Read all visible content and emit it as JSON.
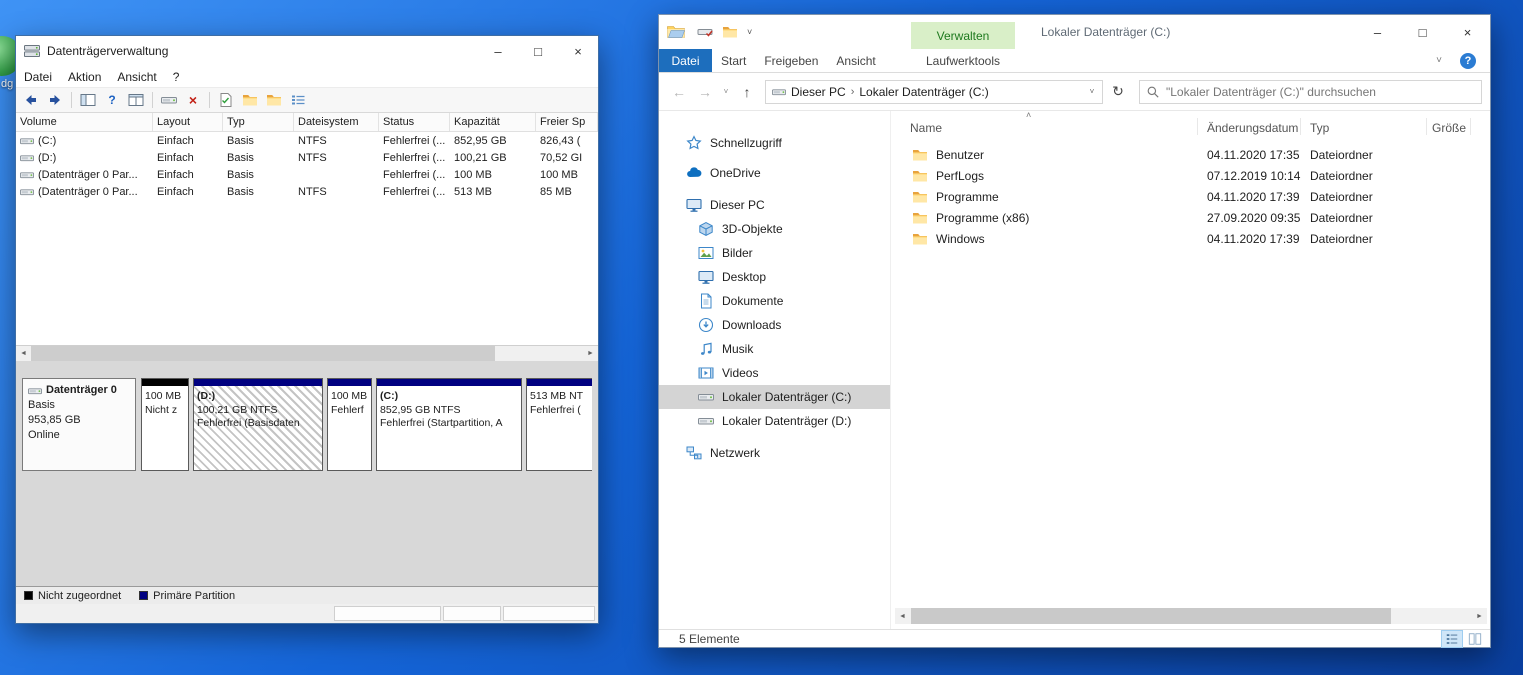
{
  "desktop": {
    "icon_label_fragment": "dg"
  },
  "glyphs": {
    "minimize": "–",
    "maximize": "□",
    "close": "×",
    "back": "←",
    "forward": "→",
    "up": "↑",
    "chevron_down": "˅",
    "caret_up": "˄",
    "refresh": "↻",
    "breadcrumb_sep": "›",
    "scroll_left": "◄",
    "scroll_right": "►",
    "help": "?",
    "delete_x": "×"
  },
  "colors": {
    "primary_partition": "#000080",
    "unallocated": "#000000",
    "file_tab_blue": "#1d6ebd",
    "manage_tab_green_bg": "#d9efc8",
    "manage_tab_green_text": "#1f7a1f",
    "sidebar_selection": "#d4d4d4",
    "folder_yellow": "#ffd978"
  },
  "disk_mgmt": {
    "title": "Datenträgerverwaltung",
    "menu": {
      "datei": "Datei",
      "aktion": "Aktion",
      "ansicht": "Ansicht",
      "hilfe": "?"
    },
    "volumes": {
      "headers": [
        "Volume",
        "Layout",
        "Typ",
        "Dateisystem",
        "Status",
        "Kapazität",
        "Freier Sp"
      ],
      "rows": [
        {
          "volume": "(C:)",
          "layout": "Einfach",
          "typ": "Basis",
          "fs": "NTFS",
          "status": "Fehlerfrei (...",
          "kapazitaet": "852,95 GB",
          "frei": "826,43 ("
        },
        {
          "volume": "(D:)",
          "layout": "Einfach",
          "typ": "Basis",
          "fs": "NTFS",
          "status": "Fehlerfrei (...",
          "kapazitaet": "100,21 GB",
          "frei": "70,52 GI"
        },
        {
          "volume": "(Datenträger 0 Par...",
          "layout": "Einfach",
          "typ": "Basis",
          "fs": "",
          "status": "Fehlerfrei (...",
          "kapazitaet": "100 MB",
          "frei": "100 MB"
        },
        {
          "volume": "(Datenträger 0 Par...",
          "layout": "Einfach",
          "typ": "Basis",
          "fs": "NTFS",
          "status": "Fehlerfrei (...",
          "kapazitaet": "513 MB",
          "frei": "85 MB"
        }
      ]
    },
    "disk0": {
      "name": "Datenträger 0",
      "typ": "Basis",
      "size": "953,85 GB",
      "status": "Online",
      "partitions": [
        {
          "line1": "100 MB",
          "line2": "Nicht z",
          "line3": ""
        },
        {
          "line1": "(D:)",
          "line2": "100,21 GB NTFS",
          "line3": "Fehlerfrei (Basisdaten"
        },
        {
          "line1": "100 MB",
          "line2": "Fehlerf",
          "line3": ""
        },
        {
          "line1": "(C:)",
          "line2": "852,95 GB NTFS",
          "line3": "Fehlerfrei (Startpartition, A"
        },
        {
          "line1": "513 MB NT",
          "line2": "Fehlerfrei (",
          "line3": ""
        }
      ]
    },
    "legend": {
      "unallocated": "Nicht zugeordnet",
      "primary": "Primäre Partition"
    }
  },
  "explorer": {
    "title": "Lokaler Datenträger (C:)",
    "manage_tab": "Verwalten",
    "file_tab": "Datei",
    "tabs": [
      "Start",
      "Freigeben",
      "Ansicht"
    ],
    "tool_tab": "Laufwerktools",
    "breadcrumb": {
      "root": "Dieser PC",
      "current": "Lokaler Datenträger (C:)"
    },
    "search_placeholder": "\"Lokaler Datenträger (C:)\" durchsuchen",
    "sidebar": {
      "items": [
        {
          "label": "Schnellzugriff"
        },
        {
          "label": "OneDrive"
        },
        {
          "label": "Dieser PC"
        },
        {
          "label": "3D-Objekte"
        },
        {
          "label": "Bilder"
        },
        {
          "label": "Desktop"
        },
        {
          "label": "Dokumente"
        },
        {
          "label": "Downloads"
        },
        {
          "label": "Musik"
        },
        {
          "label": "Videos"
        },
        {
          "label": "Lokaler Datenträger (C:)"
        },
        {
          "label": "Lokaler Datenträger (D:)"
        },
        {
          "label": "Netzwerk"
        }
      ]
    },
    "list": {
      "headers": [
        "Name",
        "Änderungsdatum",
        "Typ",
        "Größe"
      ],
      "rows": [
        {
          "name": "Benutzer",
          "date": "04.11.2020 17:35",
          "type": "Dateiordner",
          "size": ""
        },
        {
          "name": "PerfLogs",
          "date": "07.12.2019 10:14",
          "type": "Dateiordner",
          "size": ""
        },
        {
          "name": "Programme",
          "date": "04.11.2020 17:39",
          "type": "Dateiordner",
          "size": ""
        },
        {
          "name": "Programme (x86)",
          "date": "27.09.2020 09:35",
          "type": "Dateiordner",
          "size": ""
        },
        {
          "name": "Windows",
          "date": "04.11.2020 17:39",
          "type": "Dateiordner",
          "size": ""
        }
      ]
    },
    "status": "5 Elemente"
  }
}
